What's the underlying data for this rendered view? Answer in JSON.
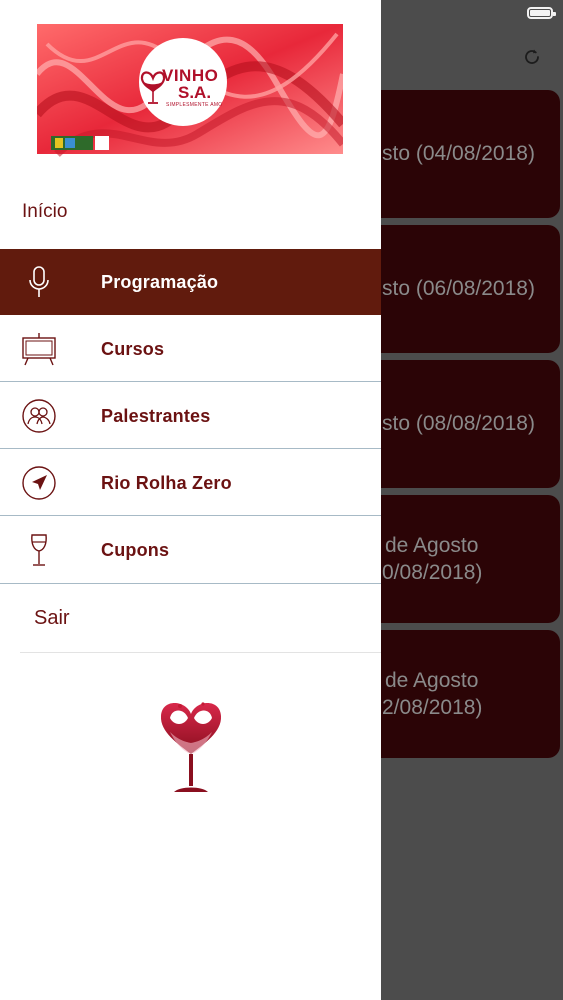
{
  "background": {
    "events": [
      {
        "line1": "sto (04/08/2018)",
        "line2": ""
      },
      {
        "line1": "sto (06/08/2018)",
        "line2": ""
      },
      {
        "line1": "sto (08/08/2018)",
        "line2": ""
      },
      {
        "line1": "de Agosto",
        "line2": "0/08/2018)"
      },
      {
        "line1": "de Agosto",
        "line2": "2/08/2018)"
      }
    ]
  },
  "drawer": {
    "logo": {
      "brand": "VINHO",
      "brand2": "S.A.",
      "tagline": "SIMPLESMENTE AMO"
    },
    "home_label": "Início",
    "menu": [
      {
        "label": "Programação",
        "icon": "microphone-icon",
        "active": true
      },
      {
        "label": "Cursos",
        "icon": "easel-icon",
        "active": false
      },
      {
        "label": "Palestrantes",
        "icon": "people-icon",
        "active": false
      },
      {
        "label": "Rio Rolha Zero",
        "icon": "location-arrow-icon",
        "active": false
      },
      {
        "label": "Cupons",
        "icon": "wine-glass-icon",
        "active": false
      }
    ],
    "logout_label": "Sair"
  },
  "colors": {
    "brand": "#611b0d",
    "text": "#6b1212",
    "card": "#2b0406",
    "divider": "#a7bac6"
  }
}
